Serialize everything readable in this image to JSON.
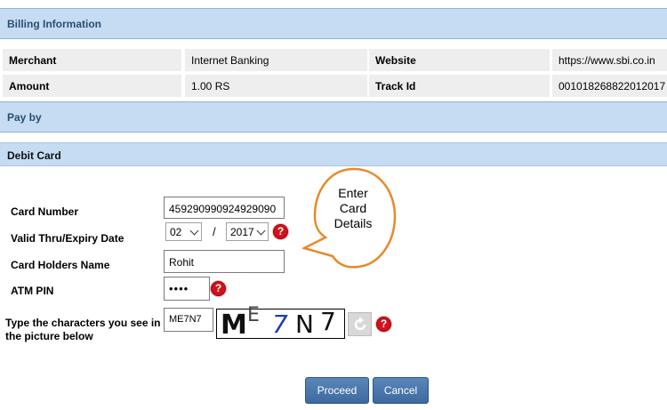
{
  "billing": {
    "header": "Billing Information",
    "merchant_label": "Merchant",
    "merchant_value": "Internet Banking",
    "website_label": "Website",
    "website_value": "https://www.sbi.co.in",
    "amount_label": "Amount",
    "amount_value": "1.00 RS",
    "track_label": "Track Id",
    "track_value": "001018268822012017"
  },
  "payby": {
    "header": "Pay by"
  },
  "debit": {
    "header": "Debit Card"
  },
  "form": {
    "card_number_label": "Card Number",
    "card_number_value": "459290990924929090",
    "expiry_label": "Valid Thru/Expiry Date",
    "expiry_month": "02",
    "expiry_separator": "/",
    "expiry_year": "2017",
    "holder_label": "Card Holders Name",
    "holder_value": "Rohit",
    "pin_label": "ATM PIN",
    "pin_value": "••••",
    "captcha_label_line1": "Type the characters you see in",
    "captcha_label_line2": "the picture below",
    "captcha_input_value": "ME7N7",
    "captcha_chars": [
      "M",
      "E",
      "7",
      "N",
      "7"
    ]
  },
  "help_glyph": "?",
  "buttons": {
    "proceed": "Proceed",
    "cancel": "Cancel"
  },
  "callout": {
    "line1": "Enter",
    "line2": "Card",
    "line3": "Details"
  },
  "colors": {
    "header_bg": "#c5dcf3",
    "button_bg": "#4a76ab",
    "help_icon": "#d4101b",
    "callout_border": "#e8892b",
    "captcha_blue_char": "#1a3fb3"
  }
}
